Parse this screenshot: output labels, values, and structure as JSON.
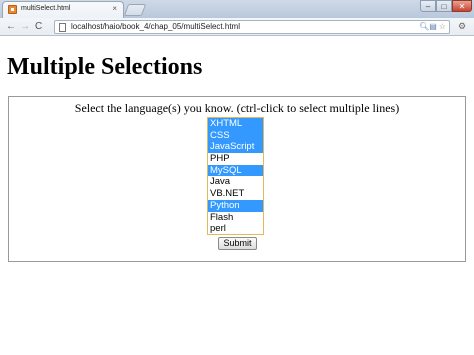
{
  "browser": {
    "tab_title": "multiSelect.html",
    "tab_close": "×",
    "address": "localhost/haio/book_4/chap_05/multiSelect.html",
    "nav": {
      "back": "←",
      "forward": "→",
      "reload": "C"
    },
    "window_buttons": {
      "minimize": "–",
      "maximize": "□",
      "close": "✕"
    }
  },
  "page": {
    "title": "Multiple Selections",
    "instruction": "Select the language(s) you know. (ctrl-click to select multiple lines)",
    "options": [
      {
        "label": "XHTML",
        "selected": true
      },
      {
        "label": "CSS",
        "selected": true
      },
      {
        "label": "JavaScript",
        "selected": true
      },
      {
        "label": "PHP",
        "selected": false
      },
      {
        "label": "MySQL",
        "selected": true
      },
      {
        "label": "Java",
        "selected": false
      },
      {
        "label": "VB.NET",
        "selected": false
      },
      {
        "label": "Python",
        "selected": true
      },
      {
        "label": "Flash",
        "selected": false
      },
      {
        "label": "perl",
        "selected": false
      }
    ],
    "submit_label": "Submit"
  },
  "colors": {
    "selection": "#3399ff",
    "focus_border": "#e4b95b"
  }
}
